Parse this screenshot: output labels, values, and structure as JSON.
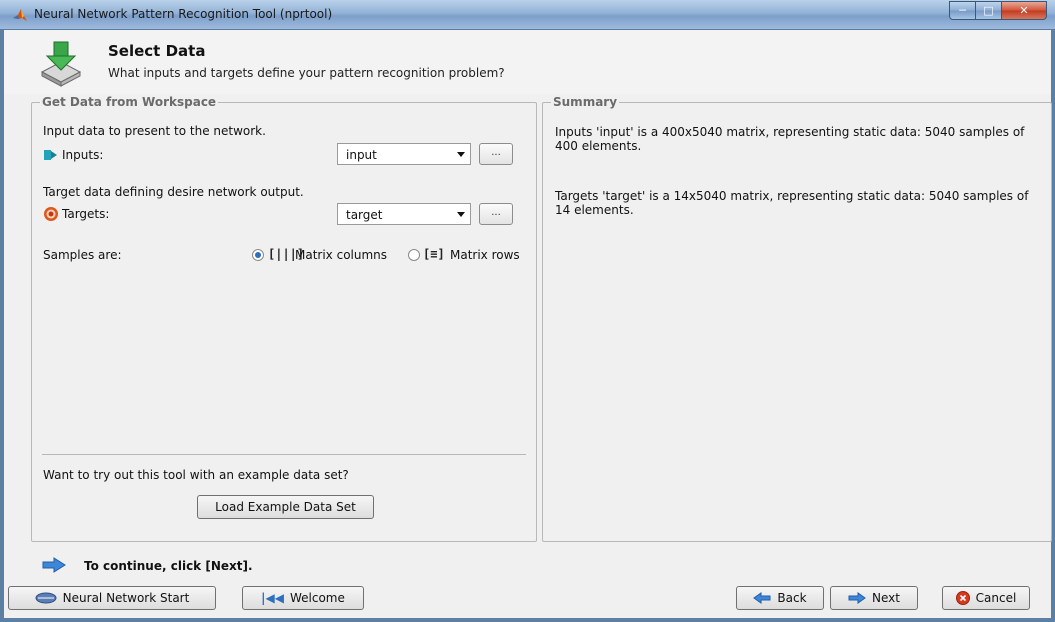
{
  "window": {
    "title": "Neural Network Pattern Recognition Tool (nprtool)",
    "icon": "matlab-logo-icon",
    "controls": [
      "minimize",
      "maximize",
      "close"
    ]
  },
  "header": {
    "title": "Select Data",
    "subtitle": "What inputs and targets define your pattern recognition problem?",
    "icon": "download-to-disk-icon"
  },
  "workspace": {
    "legend": "Get Data from Workspace",
    "input_desc": "Input data to present to the network.",
    "inputs_label": "Inputs:",
    "inputs_value": "input",
    "target_desc": "Target data defining desire network output.",
    "targets_label": "Targets:",
    "targets_value": "target",
    "browse_label": "...",
    "samples_label": "Samples are:",
    "option_columns": "Matrix columns",
    "option_rows": "Matrix rows",
    "selected_option": "columns",
    "example_prompt": "Want to try out this tool with an example data set?",
    "load_example": "Load Example Data Set"
  },
  "summary": {
    "legend": "Summary",
    "inputs_text": "Inputs 'input' is a 400x5040 matrix, representing static data: 5040 samples of 400 elements.",
    "targets_text": "Targets 'target' is a 14x5040 matrix, representing static data: 5040 samples of 14 elements."
  },
  "footer": {
    "hint": "To continue, click [Next].",
    "nn_start": "Neural Network Start",
    "welcome": "Welcome",
    "back": "Back",
    "next": "Next",
    "cancel": "Cancel"
  },
  "colors": {
    "accent": "#2c6fbf",
    "title_bar": "#92b2d6",
    "close": "#c03a1e"
  }
}
